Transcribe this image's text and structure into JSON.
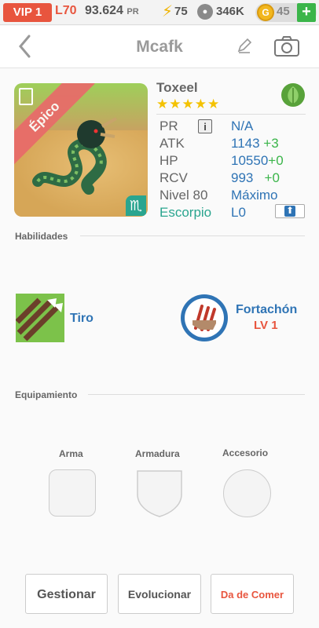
{
  "status_bar": {
    "vip": "VIP 1",
    "level": "L70",
    "power": "93.624",
    "power_unit": "PR",
    "energy": "75",
    "food": "346K",
    "coins": "45",
    "plus": "+"
  },
  "header": {
    "title": "Mcafk",
    "back_icon": "chevron-left-icon",
    "edit_icon": "pencil-icon",
    "camera_icon": "camera-icon"
  },
  "monster": {
    "name": "Toxeel",
    "stars": "★★★★★",
    "rarity": "Épico",
    "element_icon": "leaf-icon",
    "zodiac_symbol": "♏",
    "stats": [
      {
        "label": "PR",
        "value": "N/A"
      },
      {
        "label": "ATK",
        "value": "1143",
        "bonus": "+3"
      },
      {
        "label": "HP",
        "value": "10550",
        "bonus": "+0"
      },
      {
        "label": "RCV",
        "value": "993",
        "bonus": "+0"
      },
      {
        "label": "Nivel 80",
        "value": "Máximo"
      },
      {
        "label": "Escorpio",
        "value": "L0"
      }
    ],
    "info_label": "i"
  },
  "skills": {
    "title": "Habilidades",
    "items": [
      {
        "name": "Tiro"
      },
      {
        "name": "Fortachón",
        "level": "LV 1"
      }
    ]
  },
  "equipment": {
    "title": "Equipamiento",
    "slots": [
      {
        "label": "Arma"
      },
      {
        "label": "Armadura"
      },
      {
        "label": "Accesorio"
      }
    ]
  },
  "actions": {
    "manage": "Gestionar",
    "evolve": "Evolucionar",
    "feed": "Da de Comer"
  },
  "colors": {
    "accent": "#e8553e",
    "link": "#2f74b5",
    "positive": "#3bb54a",
    "zodiac": "#2aa58f"
  }
}
